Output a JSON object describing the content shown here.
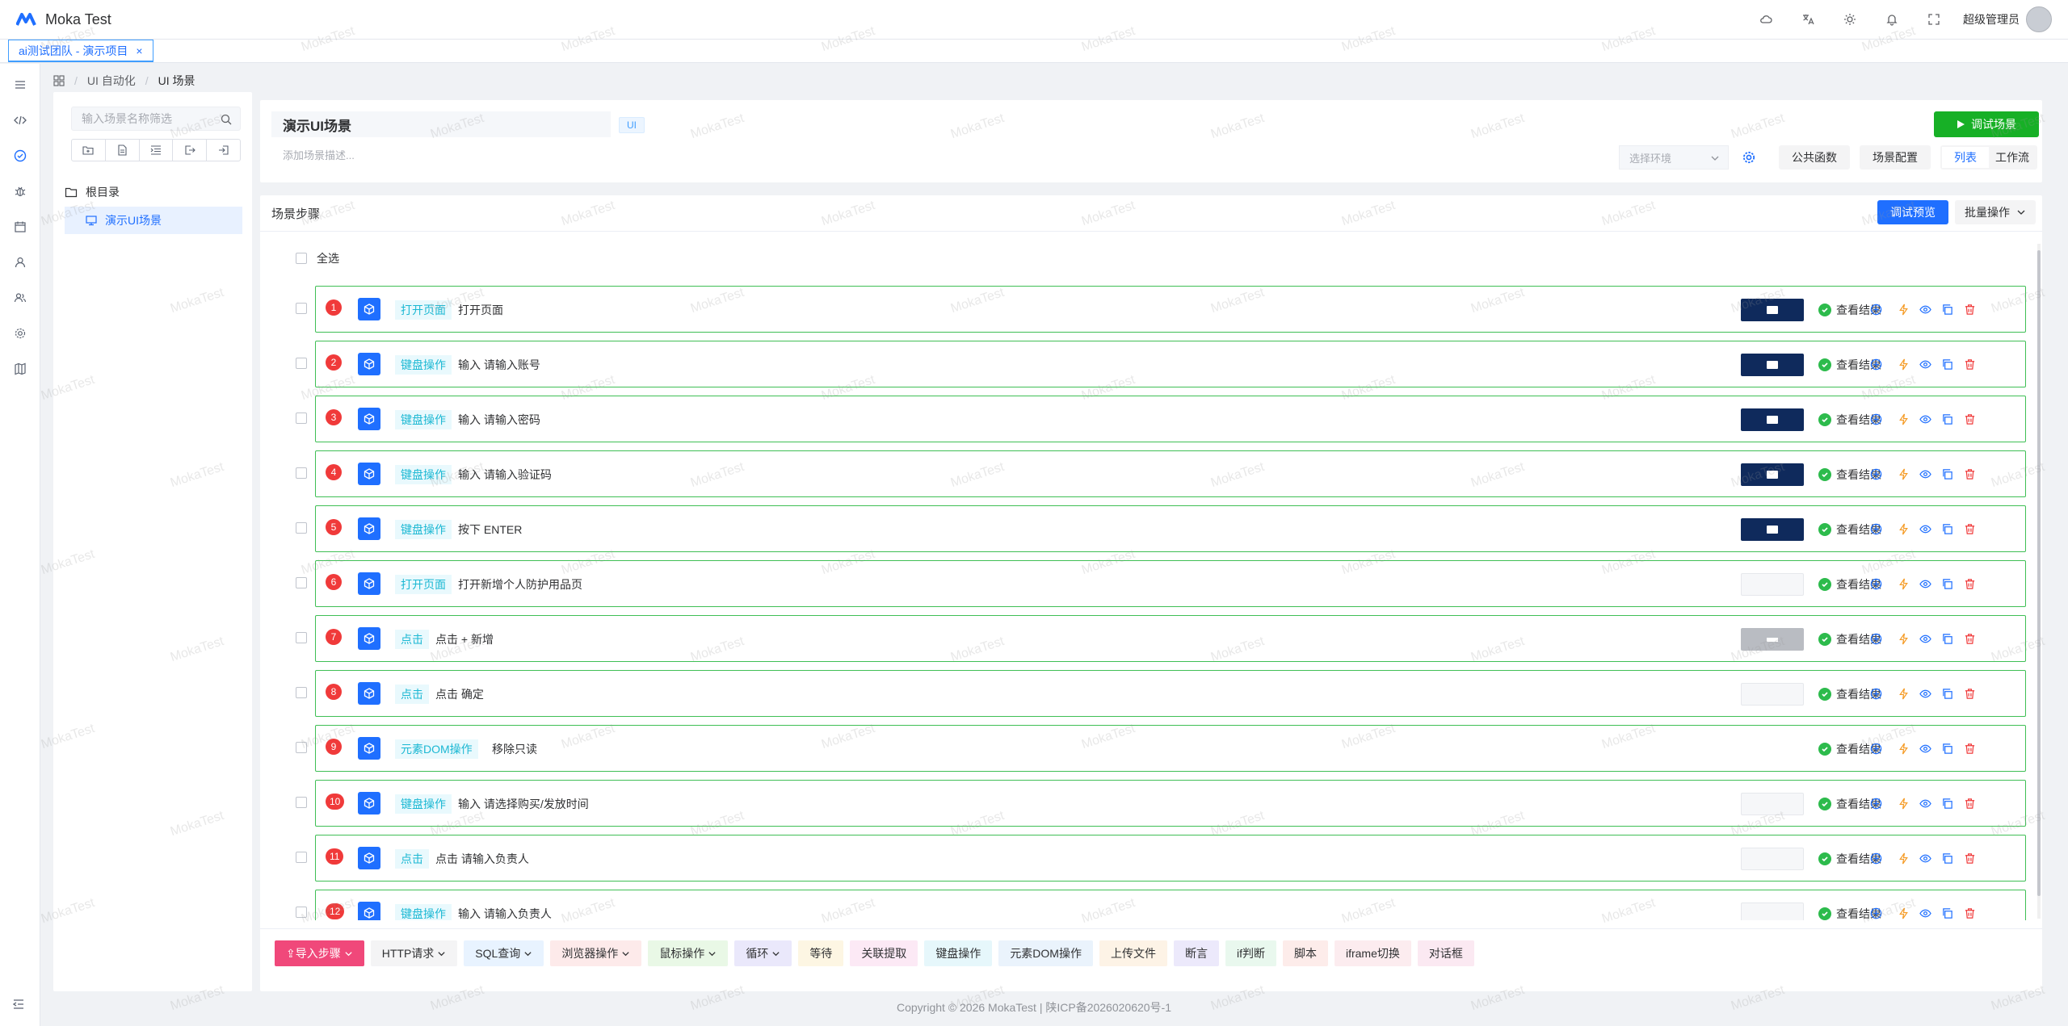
{
  "app": {
    "title": "Moka Test",
    "user_name": "超级管理员"
  },
  "tab": {
    "label": "ai测试团队 - 演示项目",
    "close": "×"
  },
  "breadcrumb": {
    "items": [
      "UI 自动化",
      "UI 场景"
    ],
    "sep": "/"
  },
  "tree": {
    "search_placeholder": "输入场景名称筛选",
    "root": "根目录",
    "leaf": "演示UI场景"
  },
  "scene": {
    "name": "演示UI场景",
    "tag": "UI",
    "desc_placeholder": "添加场景描述...",
    "debug_button": "调试场景",
    "env_placeholder": "选择环境",
    "public_functions": "公共函数",
    "scene_config": "场景配置",
    "view_list": "列表",
    "view_flow": "工作流"
  },
  "steps": {
    "title": "场景步骤",
    "debug_preview": "调试预览",
    "batch_ops": "批量操作",
    "select_all": "全选",
    "view_result": "查看结果",
    "items": [
      {
        "num": "1",
        "type": "打开页面",
        "desc": "打开页面",
        "thumb": "dark"
      },
      {
        "num": "2",
        "type": "键盘操作",
        "desc": "输入 请输入账号",
        "thumb": "dark"
      },
      {
        "num": "3",
        "type": "键盘操作",
        "desc": "输入 请输入密码",
        "thumb": "dark"
      },
      {
        "num": "4",
        "type": "键盘操作",
        "desc": "输入 请输入验证码",
        "thumb": "dark"
      },
      {
        "num": "5",
        "type": "键盘操作",
        "desc": "按下 ENTER",
        "thumb": "dark"
      },
      {
        "num": "6",
        "type": "打开页面",
        "desc": "打开新增个人防护用品页",
        "thumb": "light"
      },
      {
        "num": "7",
        "type": "点击",
        "desc": "点击 + 新增",
        "thumb": "grey"
      },
      {
        "num": "8",
        "type": "点击",
        "desc": "点击 确定",
        "thumb": "light"
      },
      {
        "num": "9",
        "type": "元素DOM操作",
        "desc": "移除只读",
        "thumb": "none"
      },
      {
        "num": "10",
        "type": "键盘操作",
        "desc": "输入 请选择购买/发放时间",
        "thumb": "light"
      },
      {
        "num": "11",
        "type": "点击",
        "desc": "点击 请输入负责人",
        "thumb": "light"
      },
      {
        "num": "12",
        "type": "键盘操作",
        "desc": "输入 请输入负责人",
        "thumb": "light"
      }
    ]
  },
  "toolbar": {
    "items": [
      {
        "label": "⇪导入步骤",
        "bg": "#f0487a",
        "fg": "#ffffff",
        "caret": true
      },
      {
        "label": "HTTP请求",
        "bg": "#f4f4f5",
        "fg": "#303133",
        "caret": true
      },
      {
        "label": "SQL查询",
        "bg": "#e8f3ff",
        "fg": "#303133",
        "caret": true
      },
      {
        "label": "浏览器操作",
        "bg": "#fdeaea",
        "fg": "#303133",
        "caret": true
      },
      {
        "label": "鼠标操作",
        "bg": "#e9f8e6",
        "fg": "#303133",
        "caret": true
      },
      {
        "label": "循环",
        "bg": "#eae8fb",
        "fg": "#303133",
        "caret": true
      },
      {
        "label": "等待",
        "bg": "#fdf6e3",
        "fg": "#303133",
        "caret": false
      },
      {
        "label": "关联提取",
        "bg": "#fce9f5",
        "fg": "#303133",
        "caret": false
      },
      {
        "label": "键盘操作",
        "bg": "#e6f7fb",
        "fg": "#303133",
        "caret": false
      },
      {
        "label": "元素DOM操作",
        "bg": "#eaf3fc",
        "fg": "#303133",
        "caret": false
      },
      {
        "label": "上传文件",
        "bg": "#fdf3e6",
        "fg": "#303133",
        "caret": false
      },
      {
        "label": "断言",
        "bg": "#ece9fb",
        "fg": "#303133",
        "caret": false
      },
      {
        "label": "if判断",
        "bg": "#e9f8ee",
        "fg": "#303133",
        "caret": false
      },
      {
        "label": "脚本",
        "bg": "#fdecea",
        "fg": "#303133",
        "caret": false
      },
      {
        "label": "iframe切换",
        "bg": "#fcecef",
        "fg": "#303133",
        "caret": false
      },
      {
        "label": "对话框",
        "bg": "#fbe9f2",
        "fg": "#303133",
        "caret": false
      }
    ]
  },
  "footer": {
    "text": "Copyright © 2026 MokaTest | 陕ICP备2026020620号-1"
  },
  "watermark": {
    "text": "MokaTest"
  },
  "colors": {
    "primary": "#1f6fff",
    "success": "#17b026",
    "step_border": "#3fbf55",
    "danger": "#f03a3a"
  }
}
